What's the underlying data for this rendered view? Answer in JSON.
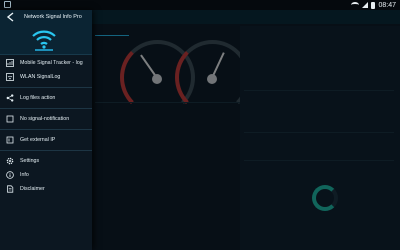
{
  "status_bar": {
    "time": "08:47"
  },
  "app": {
    "title": "Network Signal Info Pro",
    "logo": "wifi-signal-logo"
  },
  "drawer": {
    "items": [
      {
        "label": "Mobile Signal Tracker - log",
        "icon": "signal-log-icon"
      },
      {
        "label": "WLAN SignalLog",
        "icon": "wlan-log-icon"
      },
      {
        "label": "Log files action",
        "icon": "share-icon"
      },
      {
        "label": "No signal-notification",
        "icon": "notification-icon"
      },
      {
        "label": "Get external IP",
        "icon": "ip-icon"
      },
      {
        "label": "Settings",
        "icon": "gear-icon"
      },
      {
        "label": "Info",
        "icon": "info-icon"
      },
      {
        "label": "Disclaimer",
        "icon": "document-icon"
      }
    ]
  },
  "colors": {
    "accent": "#25b6e8",
    "drawer_bg": "#0c1721",
    "header_bg": "#0b2433",
    "gauge_red": "#c23c3c",
    "battery_green": "#1fb9a6"
  }
}
